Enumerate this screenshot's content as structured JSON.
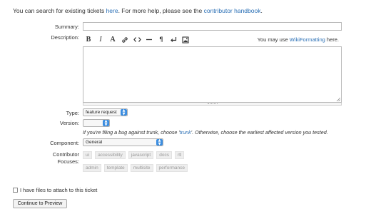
{
  "intro": {
    "prefix": "You can search for existing tickets ",
    "search_link": "here",
    "middle": ". For more help, please see the ",
    "handbook_link": "contributor handbook",
    "suffix": "."
  },
  "labels": {
    "summary": "Summary:",
    "description": "Description:",
    "type": "Type:",
    "version": "Version:",
    "component": "Component:",
    "focuses_line1": "Contributor",
    "focuses_line2": "Focuses:"
  },
  "summary": {
    "value": "",
    "placeholder": ""
  },
  "toolbar": {
    "bold": "B",
    "italic": "I",
    "heading": "A",
    "link_icon": "link-icon",
    "code_icon": "code-icon",
    "hr_icon": "horizontal-rule-icon",
    "paragraph": "¶",
    "linebreak_icon": "line-break-icon",
    "image_icon": "image-icon",
    "help_prefix": "You may use ",
    "help_link": "WikiFormatting",
    "help_suffix": " here."
  },
  "type": {
    "value": "feature request"
  },
  "version": {
    "value": "",
    "hint_prefix": "If you're filing a bug against trunk, choose '",
    "hint_trunk": "trunk",
    "hint_suffix": "'. Otherwise, choose the earliest affected version you tested."
  },
  "component": {
    "value": "General"
  },
  "focuses": {
    "row1": [
      "ui",
      "accessibility",
      "javascript",
      "docs",
      "rtl"
    ],
    "row2": [
      "admin",
      "template",
      "multisite",
      "performance"
    ]
  },
  "attach": {
    "label": "I have files to attach to this ticket"
  },
  "submit": {
    "label": "Continue to Preview"
  },
  "colors": {
    "link": "#2a6fb5",
    "select_arrow": "#3b8de0",
    "tag_bg": "#eeeeee"
  }
}
